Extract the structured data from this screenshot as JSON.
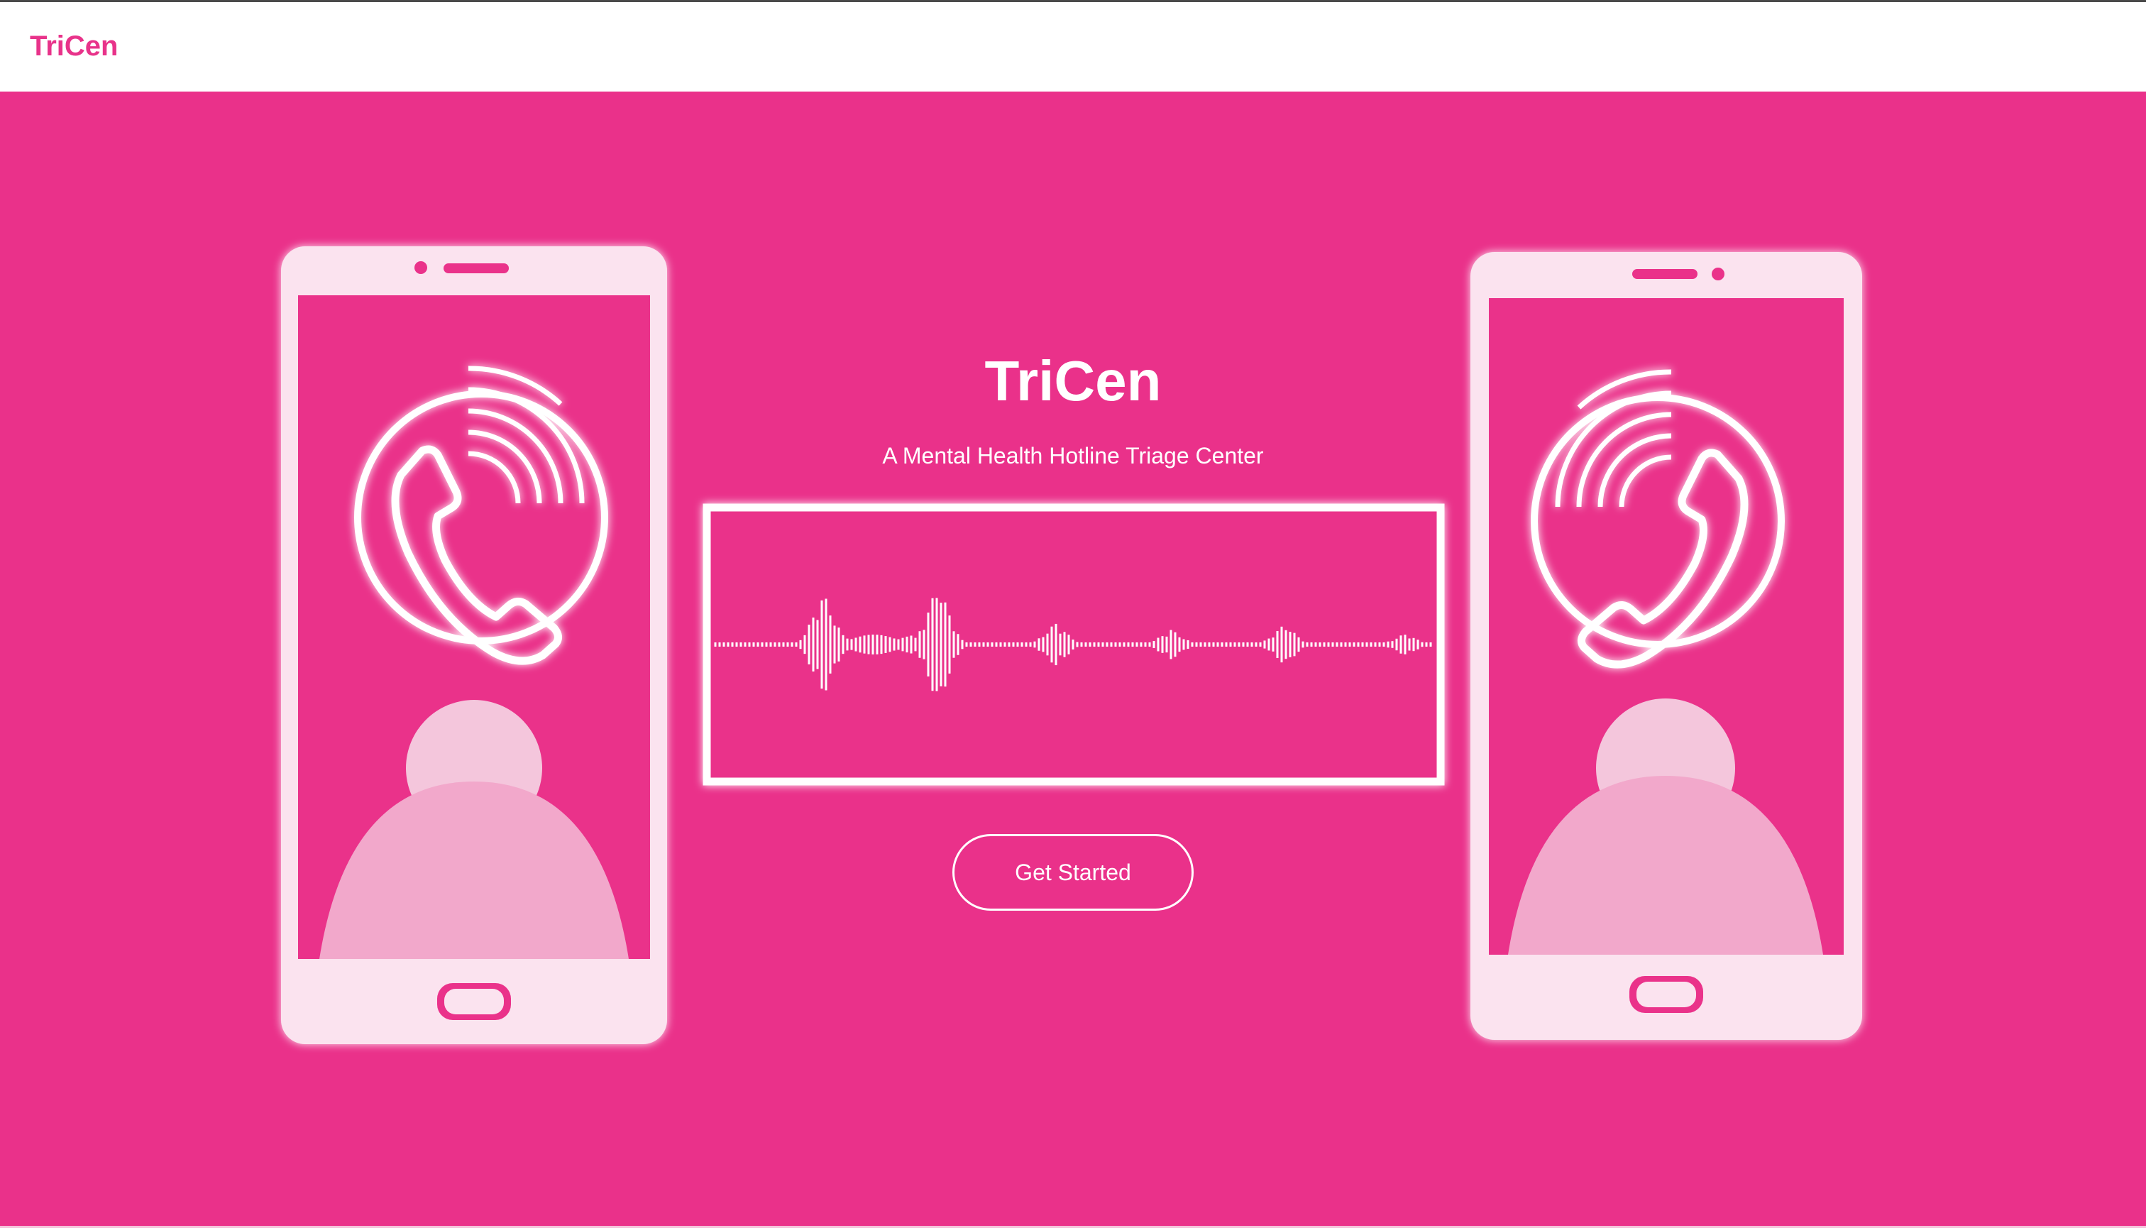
{
  "navbar": {
    "brand": "TriCen"
  },
  "hero": {
    "title": "TriCen",
    "subtitle": "A Mental Health Hotline Triage Center",
    "cta_label": "Get Started"
  },
  "colors": {
    "accent": "#ea318a",
    "brand_text": "#e8338a",
    "phone_frame": "#fbe3ef",
    "avatar": "#f4c6dc"
  },
  "illustration": {
    "icons": [
      "phone-left-icon",
      "phone-call-icon",
      "person-avatar-icon",
      "sound-waveform-icon",
      "phone-right-icon"
    ]
  }
}
